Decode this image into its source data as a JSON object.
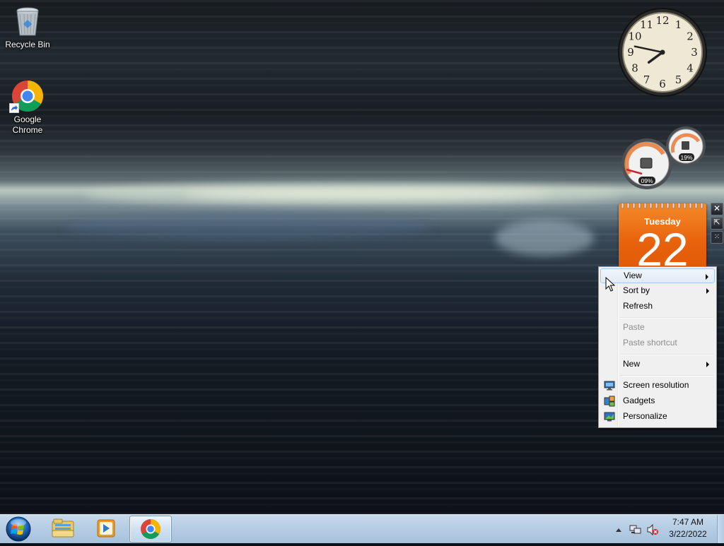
{
  "desktop": {
    "icons": [
      {
        "label": "Recycle Bin",
        "icon": "recycle-bin-icon"
      },
      {
        "label": "Google Chrome",
        "icon": "chrome-icon"
      }
    ]
  },
  "gadgets": {
    "clock": {
      "numerals": [
        "12",
        "1",
        "2",
        "3",
        "4",
        "5",
        "6",
        "7",
        "8",
        "9",
        "10",
        "11"
      ],
      "time": "7:47"
    },
    "cpu_meter": {
      "cpu_percent": "09%",
      "memory_percent": "19%"
    },
    "calendar": {
      "weekday": "Tuesday",
      "date": "22"
    },
    "controls": [
      "close-icon",
      "resize-icon",
      "drag-grip-icon"
    ]
  },
  "context_menu": {
    "items": [
      {
        "label": "View",
        "submenu": true,
        "state": "highlighted"
      },
      {
        "label": "Sort by",
        "submenu": true
      },
      {
        "label": "Refresh"
      },
      {
        "label": "Paste",
        "disabled": true
      },
      {
        "label": "Paste shortcut",
        "disabled": true
      },
      {
        "label": "New",
        "submenu": true
      },
      {
        "label": "Screen resolution",
        "icon": "display-icon"
      },
      {
        "label": "Gadgets",
        "icon": "gadgets-icon"
      },
      {
        "label": "Personalize",
        "icon": "personalize-icon"
      }
    ]
  },
  "taskbar": {
    "start": "start-orb-icon",
    "pinned": [
      "file-explorer-icon",
      "media-player-icon",
      "chrome-icon"
    ],
    "tray": {
      "icons": [
        "show-hidden-icons-arrow",
        "network-icon",
        "volume-muted-icon"
      ],
      "time": "7:47 AM",
      "date": "3/22/2022"
    }
  },
  "colors": {
    "calendar_orange": "#e8620c",
    "taskbar": "#b6cde4",
    "menu_bg": "#f0f0f0",
    "menu_highlight": "#dce8f5"
  }
}
